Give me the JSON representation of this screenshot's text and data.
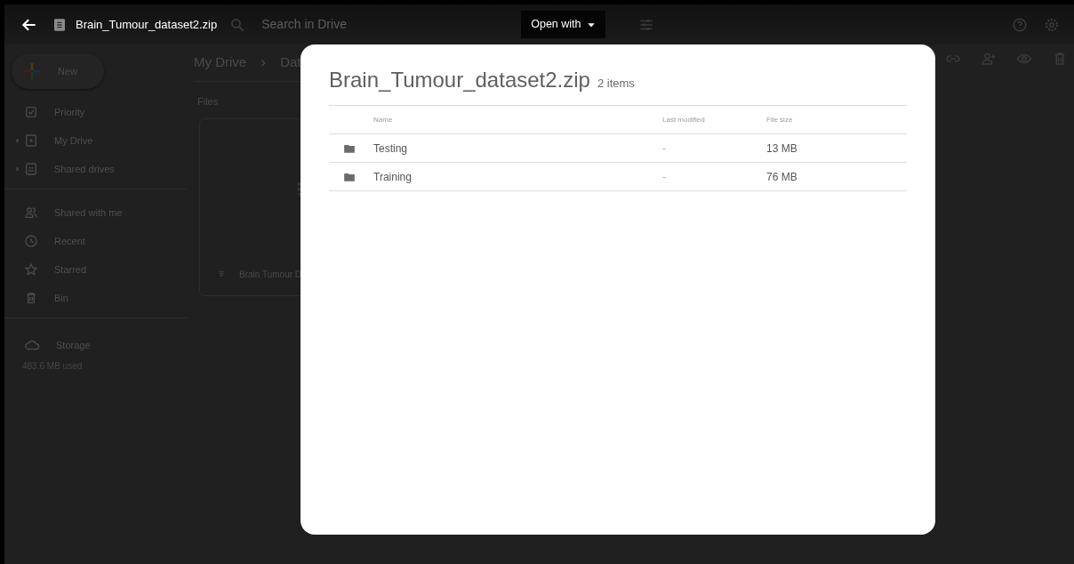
{
  "topbar": {
    "title": "Brain_Tumour_dataset2.zip",
    "search": {
      "placeholder": "Search in Drive"
    },
    "open_with": "Open with"
  },
  "sidebar": {
    "new_button": "New",
    "groups": [
      {
        "items": [
          {
            "label": "Priority",
            "expandable": false
          },
          {
            "label": "My Drive",
            "expandable": true
          },
          {
            "label": "Shared drives",
            "expandable": true
          }
        ]
      },
      {
        "items": [
          {
            "label": "Shared with me",
            "expandable": false
          },
          {
            "label": "Recent",
            "expandable": false
          },
          {
            "label": "Starred",
            "expandable": false
          },
          {
            "label": "Bin",
            "expandable": false
          }
        ]
      }
    ],
    "storage": {
      "label": "Storage",
      "used": "483.6 MB used"
    }
  },
  "main": {
    "breadcrumb": [
      "My Drive",
      "Dat"
    ],
    "section": "Files",
    "file_card": {
      "name": "Brain Tumour D"
    }
  },
  "dialog": {
    "title": "Brain_Tumour_dataset2.zip",
    "count": "2 items",
    "columns": [
      "Name",
      "Last modified",
      "File size"
    ],
    "rows": [
      {
        "name": "Testing",
        "modified": "-",
        "size": "13 MB"
      },
      {
        "name": "Training",
        "modified": "-",
        "size": "76 MB"
      }
    ]
  }
}
